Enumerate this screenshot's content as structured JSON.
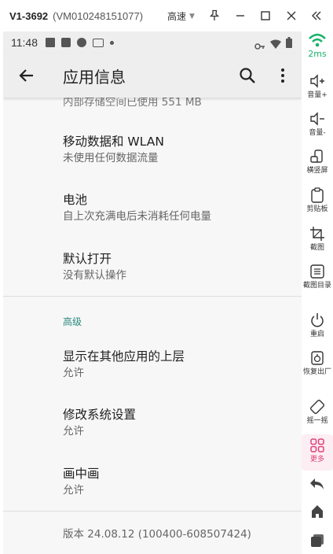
{
  "window": {
    "device_id": "V1-3692",
    "vm_id": "(VM010248151077)",
    "quality": "高速",
    "icons": [
      "pin-icon",
      "minimize-icon",
      "maximize-icon",
      "close-icon",
      "collapse-icon"
    ]
  },
  "statusbar": {
    "time": "11:48"
  },
  "appbar": {
    "title": "应用信息",
    "icons": [
      "back-arrow-icon",
      "search-icon",
      "more-vert-icon"
    ]
  },
  "content": {
    "cutoff_text": "内部存储空间已使用 551 MB",
    "items": [
      {
        "title": "移动数据和 WLAN",
        "subtitle": "未使用任何数据流量"
      },
      {
        "title": "电池",
        "subtitle": "自上次充满电后未消耗任何电量"
      },
      {
        "title": "默认打开",
        "subtitle": "没有默认操作"
      }
    ],
    "advanced_header": "高级",
    "advanced_items": [
      {
        "title": "显示在其他应用的上层",
        "subtitle": "允许"
      },
      {
        "title": "修改系统设置",
        "subtitle": "允许"
      },
      {
        "title": "画中画",
        "subtitle": "允许"
      }
    ],
    "version": "版本 24.08.12 (100400-608507424)"
  },
  "sidebar": {
    "ping": "2ms",
    "buttons": [
      {
        "label": "音量+",
        "icon": "volume-up-icon"
      },
      {
        "label": "音量-",
        "icon": "volume-down-icon"
      },
      {
        "label": "横竖屏",
        "icon": "rotate-icon"
      },
      {
        "label": "剪贴板",
        "icon": "clipboard-icon"
      },
      {
        "label": "截图",
        "icon": "crop-icon"
      },
      {
        "label": "截图目录",
        "icon": "screenshot-list-icon"
      },
      {
        "label": "重启",
        "icon": "power-icon"
      },
      {
        "label": "恢复出厂",
        "icon": "factory-reset-icon"
      },
      {
        "label": "摇一摇",
        "icon": "shake-icon"
      },
      {
        "label": "更多",
        "icon": "more-grid-icon"
      }
    ],
    "nav_icons": [
      "nav-back-icon",
      "nav-home-icon",
      "nav-recent-icon"
    ],
    "accent_color": "#e0407a",
    "signal_color": "#18b36b"
  }
}
